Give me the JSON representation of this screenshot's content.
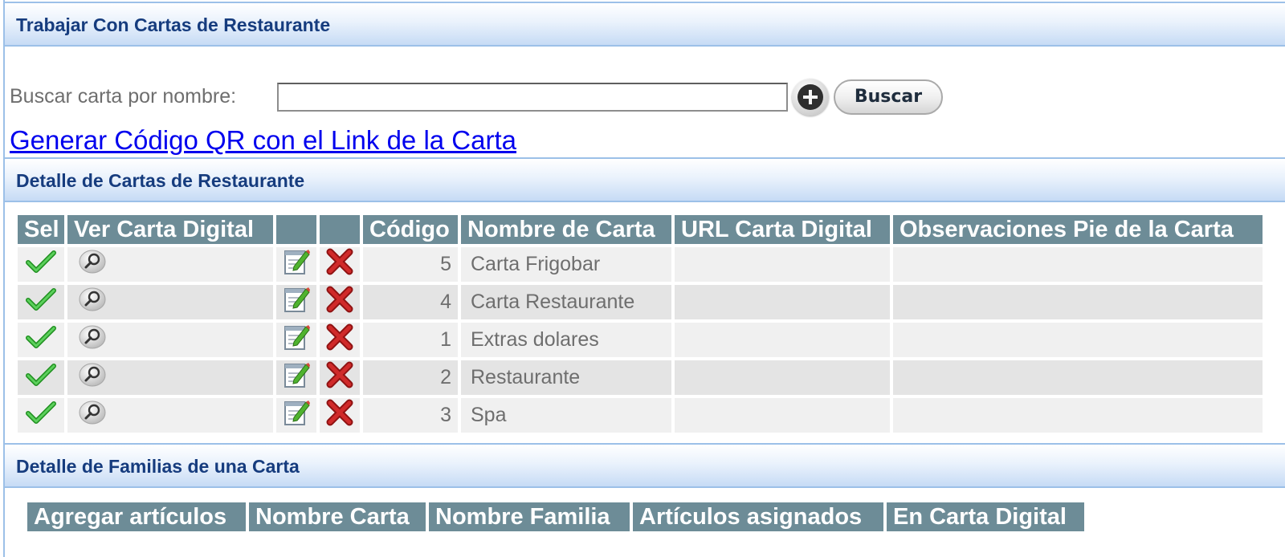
{
  "sections": {
    "main_title": "Trabajar Con Cartas de Restaurante",
    "detalle_cartas": "Detalle de Cartas de Restaurante",
    "detalle_familias": "Detalle de Familias de una Carta"
  },
  "search": {
    "label": "Buscar carta por nombre:",
    "value": "",
    "placeholder": "",
    "add_icon": "plus-circle-icon",
    "button_label": "Buscar"
  },
  "qr_link": "Generar Código QR con el Link de la Carta",
  "cartas_table": {
    "headers": [
      "Sel",
      "Ver Carta Digital",
      "",
      "",
      "Código",
      "Nombre de Carta",
      "URL Carta Digital",
      "Observaciones Pie de la Carta"
    ],
    "icons": {
      "select": "green-check-icon",
      "view": "magnifier-icon",
      "edit": "edit-notepad-icon",
      "delete": "red-x-icon"
    },
    "rows": [
      {
        "codigo": "5",
        "nombre": "Carta Frigobar",
        "url": "",
        "observaciones": ""
      },
      {
        "codigo": "4",
        "nombre": "Carta Restaurante",
        "url": "",
        "observaciones": ""
      },
      {
        "codigo": "1",
        "nombre": "Extras dolares",
        "url": "",
        "observaciones": ""
      },
      {
        "codigo": "2",
        "nombre": "Restaurante",
        "url": "",
        "observaciones": ""
      },
      {
        "codigo": "3",
        "nombre": "Spa",
        "url": "",
        "observaciones": ""
      }
    ]
  },
  "familias_table": {
    "headers": [
      "Agregar artículos",
      "Nombre Carta",
      "Nombre Familia",
      "Artículos asignados",
      "En Carta Digital"
    ]
  },
  "colors": {
    "header_bg": "#6d8c97",
    "section_title": "#163c7e",
    "section_border": "#9cc0e8",
    "row_odd": "#f0f0f0",
    "row_even": "#e4e4e4",
    "link": "#0000ee"
  }
}
